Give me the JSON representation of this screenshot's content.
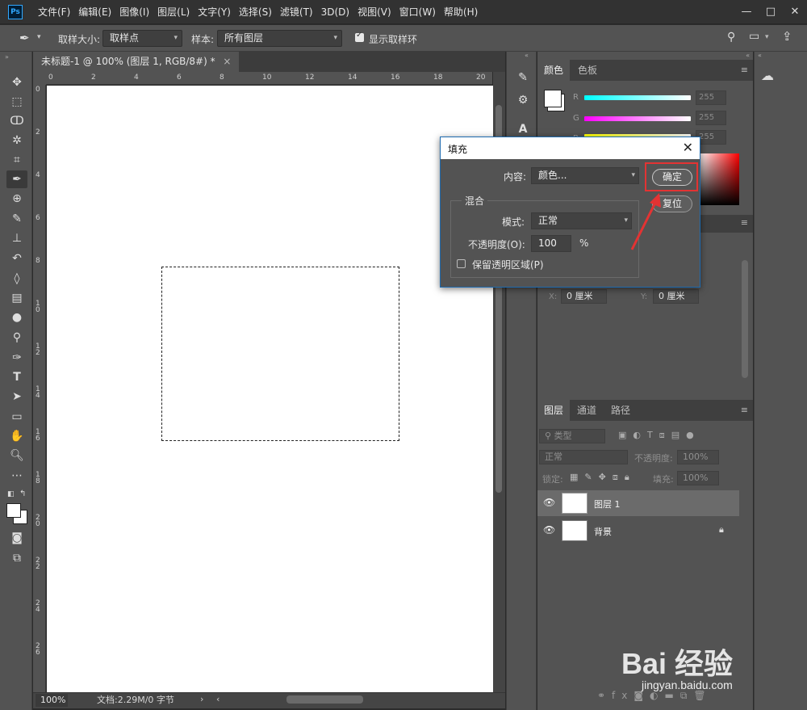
{
  "app": {
    "logo": "Ps"
  },
  "menus": [
    "文件(F)",
    "编辑(E)",
    "图像(I)",
    "图层(L)",
    "文字(Y)",
    "选择(S)",
    "滤镜(T)",
    "3D(D)",
    "视图(V)",
    "窗口(W)",
    "帮助(H)"
  ],
  "window_controls": {
    "minimize": "—",
    "maximize": "□",
    "close": "✕"
  },
  "options_bar": {
    "sample_size_label": "取样大小:",
    "sample_size_value": "取样点",
    "sample_label": "样本:",
    "sample_value": "所有图层",
    "show_ring_label": "显示取样环",
    "show_ring_checked": true
  },
  "document": {
    "tab_title": "未标题-1 @ 100% (图层 1, RGB/8#) *",
    "tab_close": "×",
    "ruler_h": [
      "0",
      "2",
      "4",
      "6",
      "8",
      "10",
      "12",
      "14",
      "16",
      "18",
      "20"
    ],
    "ruler_v": [
      "0",
      "2",
      "4",
      "6",
      "8",
      "10",
      "12",
      "14",
      "16",
      "18",
      "20",
      "22",
      "24",
      "26"
    ],
    "zoom": "100%",
    "doc_info": "文档:2.29M/0 字节"
  },
  "color_panel": {
    "tabs": [
      "颜色",
      "色板"
    ],
    "sliders": [
      {
        "label": "R",
        "value": "255",
        "color": "#00ffff"
      },
      {
        "label": "G",
        "value": "255",
        "color": "#ff00ff"
      },
      {
        "label": "B",
        "value": "255",
        "color": "#ffff00"
      }
    ]
  },
  "properties": {
    "x_label": "X:",
    "x_value": "0 厘米",
    "y_label": "Y:",
    "y_value": "0 厘米"
  },
  "layers_panel": {
    "tabs": [
      "图层",
      "通道",
      "路径"
    ],
    "filter_placeholder": "类型",
    "blend_mode": "正常",
    "opacity_label": "不透明度:",
    "opacity_value": "100%",
    "lock_label": "锁定:",
    "fill_label": "填充:",
    "fill_value": "100%",
    "layers": [
      {
        "name": "图层 1",
        "selected": true,
        "locked": false
      },
      {
        "name": "背景",
        "selected": false,
        "locked": true
      }
    ]
  },
  "fill_dialog": {
    "title": "填充",
    "close": "✕",
    "contents_label": "内容:",
    "contents_value": "颜色...",
    "ok_label": "确定",
    "reset_label": "复位",
    "blend_group": "混合",
    "mode_label": "模式:",
    "mode_value": "正常",
    "opacity_label": "不透明度(O):",
    "opacity_value": "100",
    "opacity_unit": "%",
    "preserve_label": "保留透明区域(P)",
    "preserve_checked": false
  },
  "watermark": {
    "brand": "Bai 经验",
    "url": "jingyan.baidu.com"
  },
  "colors": {
    "highlight": "#e33333",
    "dialog_border": "#1e6bb0",
    "panel": "#535353"
  }
}
